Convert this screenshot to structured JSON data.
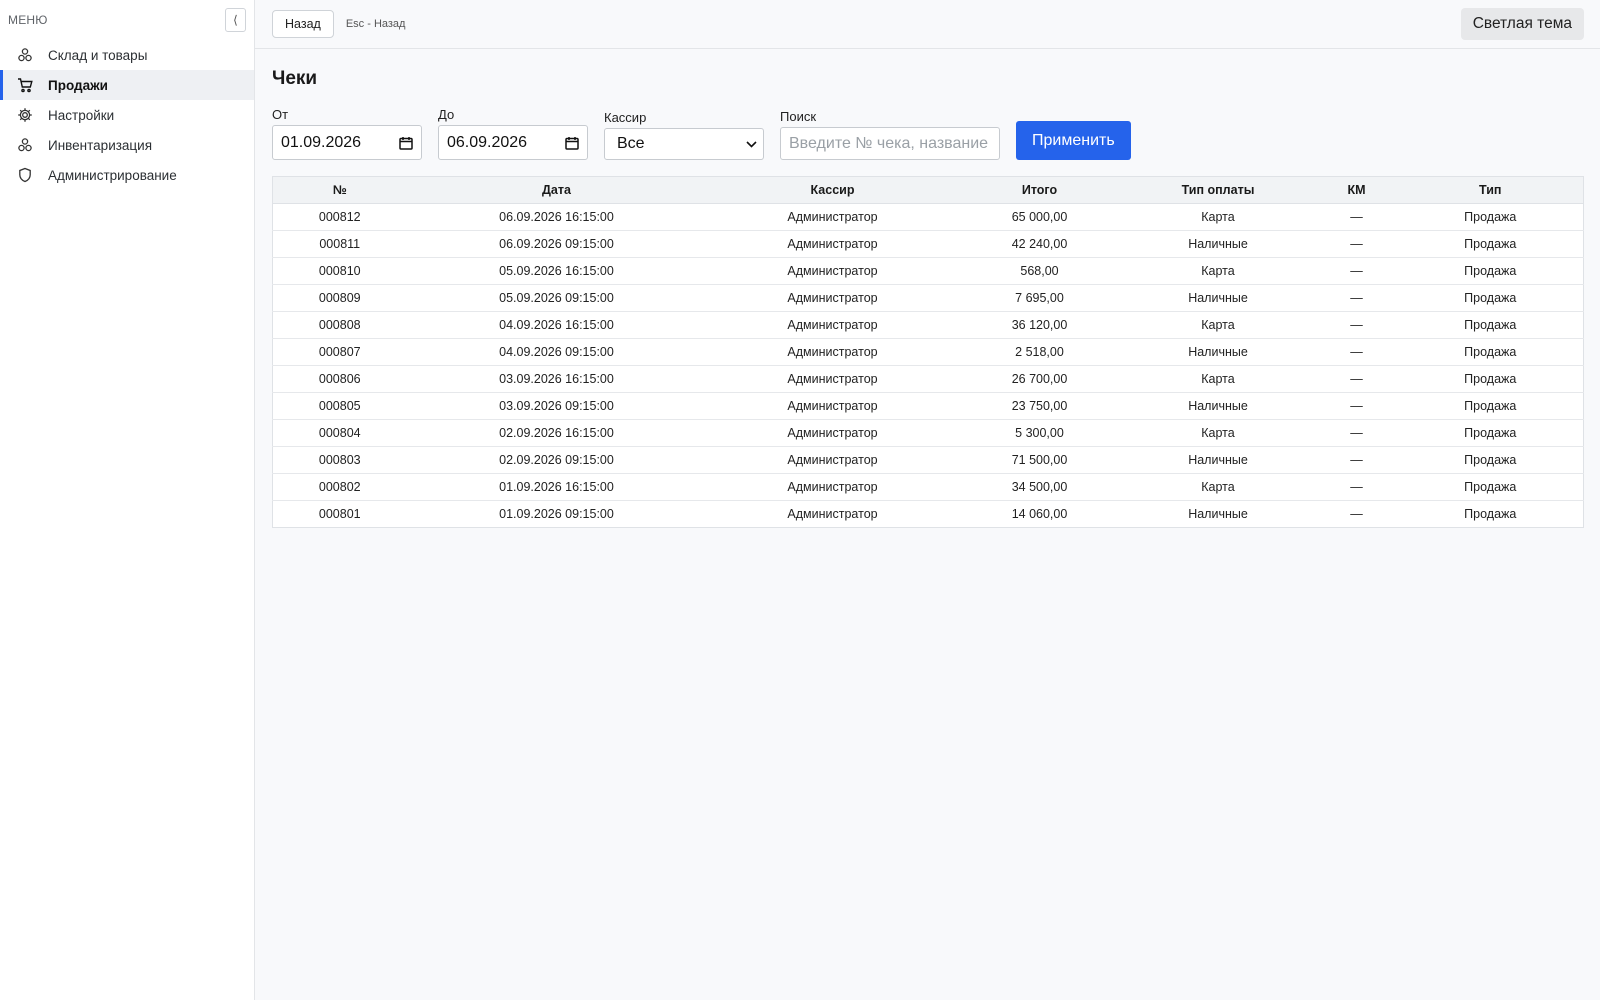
{
  "sidebar": {
    "menu_label": "МЕНЮ",
    "collapse_glyph": "⟨",
    "items": [
      {
        "label": "Склад и товары",
        "icon": "boxes-icon",
        "active": false
      },
      {
        "label": "Продажи",
        "icon": "cart-icon",
        "active": true
      },
      {
        "label": "Настройки",
        "icon": "gear-icon",
        "active": false
      },
      {
        "label": "Инвентаризация",
        "icon": "boxes-icon",
        "active": false
      },
      {
        "label": "Администрирование",
        "icon": "shield-icon",
        "active": false
      }
    ]
  },
  "topbar": {
    "back_label": "Назад",
    "esc_hint": "Esc - Назад",
    "theme_label": "Светлая тема"
  },
  "page": {
    "title": "Чеки"
  },
  "filters": {
    "from_label": "От",
    "from_value": "01.09.2026",
    "to_label": "До",
    "to_value": "06.09.2026",
    "cashier_label": "Кассир",
    "cashier_value": "Все",
    "search_label": "Поиск",
    "search_placeholder": "Введите № чека, название",
    "apply_label": "Применить"
  },
  "table": {
    "columns": [
      "№",
      "Дата",
      "Кассир",
      "Итого",
      "Тип оплаты",
      "КМ",
      "Тип"
    ],
    "rows": [
      [
        "000812",
        "06.09.2026 16:15:00",
        "Администратор",
        "65 000,00",
        "Карта",
        "—",
        "Продажа"
      ],
      [
        "000811",
        "06.09.2026 09:15:00",
        "Администратор",
        "42 240,00",
        "Наличные",
        "—",
        "Продажа"
      ],
      [
        "000810",
        "05.09.2026 16:15:00",
        "Администратор",
        "568,00",
        "Карта",
        "—",
        "Продажа"
      ],
      [
        "000809",
        "05.09.2026 09:15:00",
        "Администратор",
        "7 695,00",
        "Наличные",
        "—",
        "Продажа"
      ],
      [
        "000808",
        "04.09.2026 16:15:00",
        "Администратор",
        "36 120,00",
        "Карта",
        "—",
        "Продажа"
      ],
      [
        "000807",
        "04.09.2026 09:15:00",
        "Администратор",
        "2 518,00",
        "Наличные",
        "—",
        "Продажа"
      ],
      [
        "000806",
        "03.09.2026 16:15:00",
        "Администратор",
        "26 700,00",
        "Карта",
        "—",
        "Продажа"
      ],
      [
        "000805",
        "03.09.2026 09:15:00",
        "Администратор",
        "23 750,00",
        "Наличные",
        "—",
        "Продажа"
      ],
      [
        "000804",
        "02.09.2026 16:15:00",
        "Администратор",
        "5 300,00",
        "Карта",
        "—",
        "Продажа"
      ],
      [
        "000803",
        "02.09.2026 09:15:00",
        "Администратор",
        "71 500,00",
        "Наличные",
        "—",
        "Продажа"
      ],
      [
        "000802",
        "01.09.2026 16:15:00",
        "Администратор",
        "34 500,00",
        "Карта",
        "—",
        "Продажа"
      ],
      [
        "000801",
        "01.09.2026 09:15:00",
        "Администратор",
        "14 060,00",
        "Наличные",
        "—",
        "Продажа"
      ]
    ]
  },
  "colors": {
    "accent": "#2563eb"
  }
}
